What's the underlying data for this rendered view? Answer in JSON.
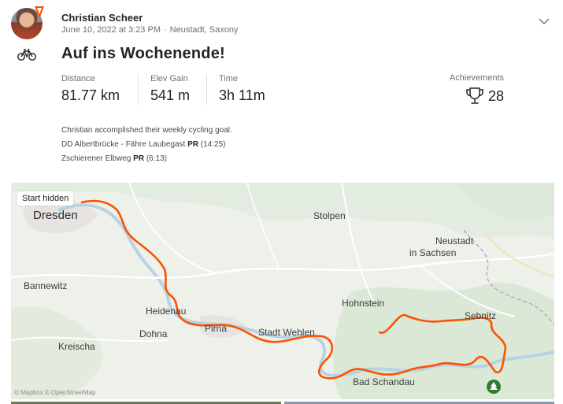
{
  "athlete": {
    "name": "Christian Scheer",
    "date": "June 10, 2022 at 3:23 PM",
    "location": "Neustadt, Saxony"
  },
  "activity": {
    "type_icon": "bicycle-icon",
    "title": "Auf ins Wochenende!"
  },
  "stats": [
    {
      "label": "Distance",
      "value": "81.77 km"
    },
    {
      "label": "Elev Gain",
      "value": "541 m"
    },
    {
      "label": "Time",
      "value": "3h 11m"
    }
  ],
  "achievements": {
    "label": "Achievements",
    "count": "28",
    "icon": "trophy-icon"
  },
  "notes": {
    "goal": "Christian accomplished their weekly cycling goal.",
    "segments": [
      {
        "name": "DD Albertbrücke - Fähre Laubegast",
        "badge": "PR",
        "time": "(14:25)"
      },
      {
        "name": "Zschierener Elbweg",
        "badge": "PR",
        "time": "(6:13)"
      }
    ]
  },
  "map": {
    "start_hidden": "Start hidden",
    "attribution": "© Mapbox © OpenStreetMap",
    "places": {
      "dresden": "Dresden",
      "stolpen": "Stolpen",
      "neustadt": "Neustadt",
      "in_sachsen": "in Sachsen",
      "bannewitz": "Bannewitz",
      "heidenau": "Heidenau",
      "pirna": "Pirna",
      "dohna": "Dohna",
      "stadt_wehlen": "Stadt Wehlen",
      "hohnstein": "Hohnstein",
      "sebnitz": "Sebnitz",
      "kreischa": "Kreischa",
      "bad_schandau": "Bad Schandau"
    },
    "route_color": "#fc5200"
  },
  "colors": {
    "brand": "#fc5200",
    "text": "#242428",
    "muted": "#6d6d78"
  }
}
